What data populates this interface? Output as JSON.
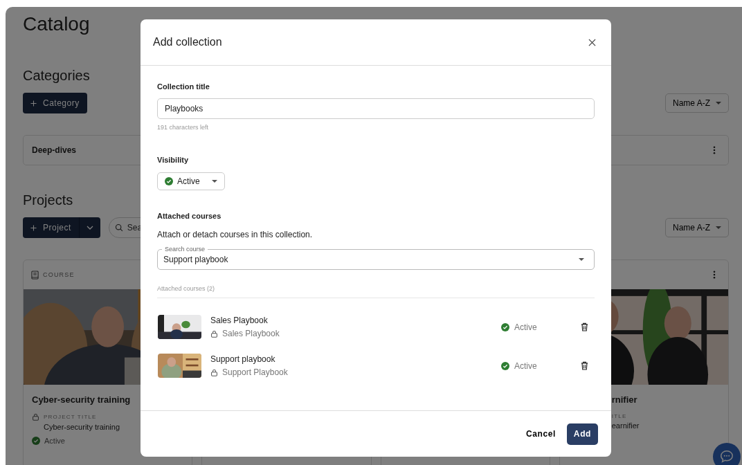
{
  "page": {
    "title": "Catalog"
  },
  "categories": {
    "heading": "Categories",
    "add_button": "Category",
    "sort": "Name A-Z",
    "items": [
      {
        "name": "Deep-dives"
      }
    ]
  },
  "projects": {
    "heading": "Projects",
    "add_button": "Project",
    "search_placeholder": "Sea",
    "sort": "Name A-Z",
    "cards": [
      {
        "type_label": "COURSE",
        "title": "Cyber-security training",
        "field_label": "PROJECT TITLE",
        "field_value": "Cyber-security training",
        "status": {
          "label": "Active",
          "active": true
        }
      },
      {
        "title": "rnifier",
        "field_label": "ITLE",
        "field_value": "earnifier",
        "menu": true
      }
    ]
  },
  "dialog": {
    "title": "Add collection",
    "title_field": {
      "label": "Collection title",
      "value": "Playbooks",
      "hint": "191 characters left"
    },
    "visibility": {
      "label": "Visibility",
      "value": "Active",
      "active": true
    },
    "courses": {
      "heading": "Attached courses",
      "description": "Attach or detach courses in this collection.",
      "search": {
        "label": "Search course",
        "value": "Support playbook"
      },
      "list_label": "Attached courses (2)",
      "items": [
        {
          "title": "Sales Playbook",
          "project": "Sales Playbook",
          "status": "Active",
          "active": true
        },
        {
          "title": "Support playbook",
          "project": "Support Playbook",
          "status": "Active",
          "active": true
        }
      ]
    },
    "cancel": "Cancel",
    "add": "Add"
  }
}
